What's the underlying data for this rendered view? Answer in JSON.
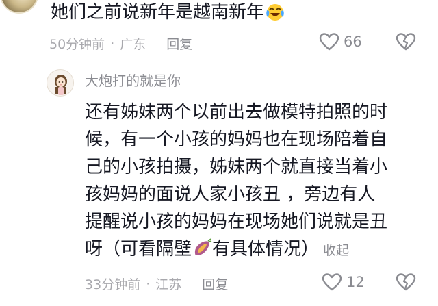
{
  "comment1": {
    "text": "她们之前说新年是越南新年",
    "emoji": "laughing-crying-emoji",
    "time": "50分钟前",
    "location": "广东",
    "separator": "·",
    "reply_label": "回复",
    "like_count": "66",
    "like_icon": "heart-outline-icon",
    "dislike_icon": "broken-heart-icon"
  },
  "comment2": {
    "username": "大炮打的就是你",
    "avatar_icon": "girl-cartoon-avatar",
    "lines": [
      "还有姊妹两个以前出去做模特拍照的时",
      "候，有一个小孩的妈妈也在现场陪着自",
      "己的小孩拍摄，姊妹两个就直接当着小",
      "孩妈妈的面说人家小孩丑 ，旁边有人",
      "提醒说小孩的妈妈在现场她们说就是丑"
    ],
    "last_line_before_icon": "呀（可看隔壁",
    "last_line_after_icon": "有具体情况）",
    "inline_icon": "sweet-potato-icon",
    "collapse_label": "收起",
    "time": "33分钟前",
    "location": "江苏",
    "separator": "·",
    "reply_label": "回复",
    "like_count": "12",
    "like_icon": "heart-outline-icon",
    "dislike_icon": "broken-heart-icon"
  },
  "colors": {
    "text_primary": "#161823",
    "text_secondary": "#8a8b91",
    "text_meta": "#a8a8ad"
  }
}
